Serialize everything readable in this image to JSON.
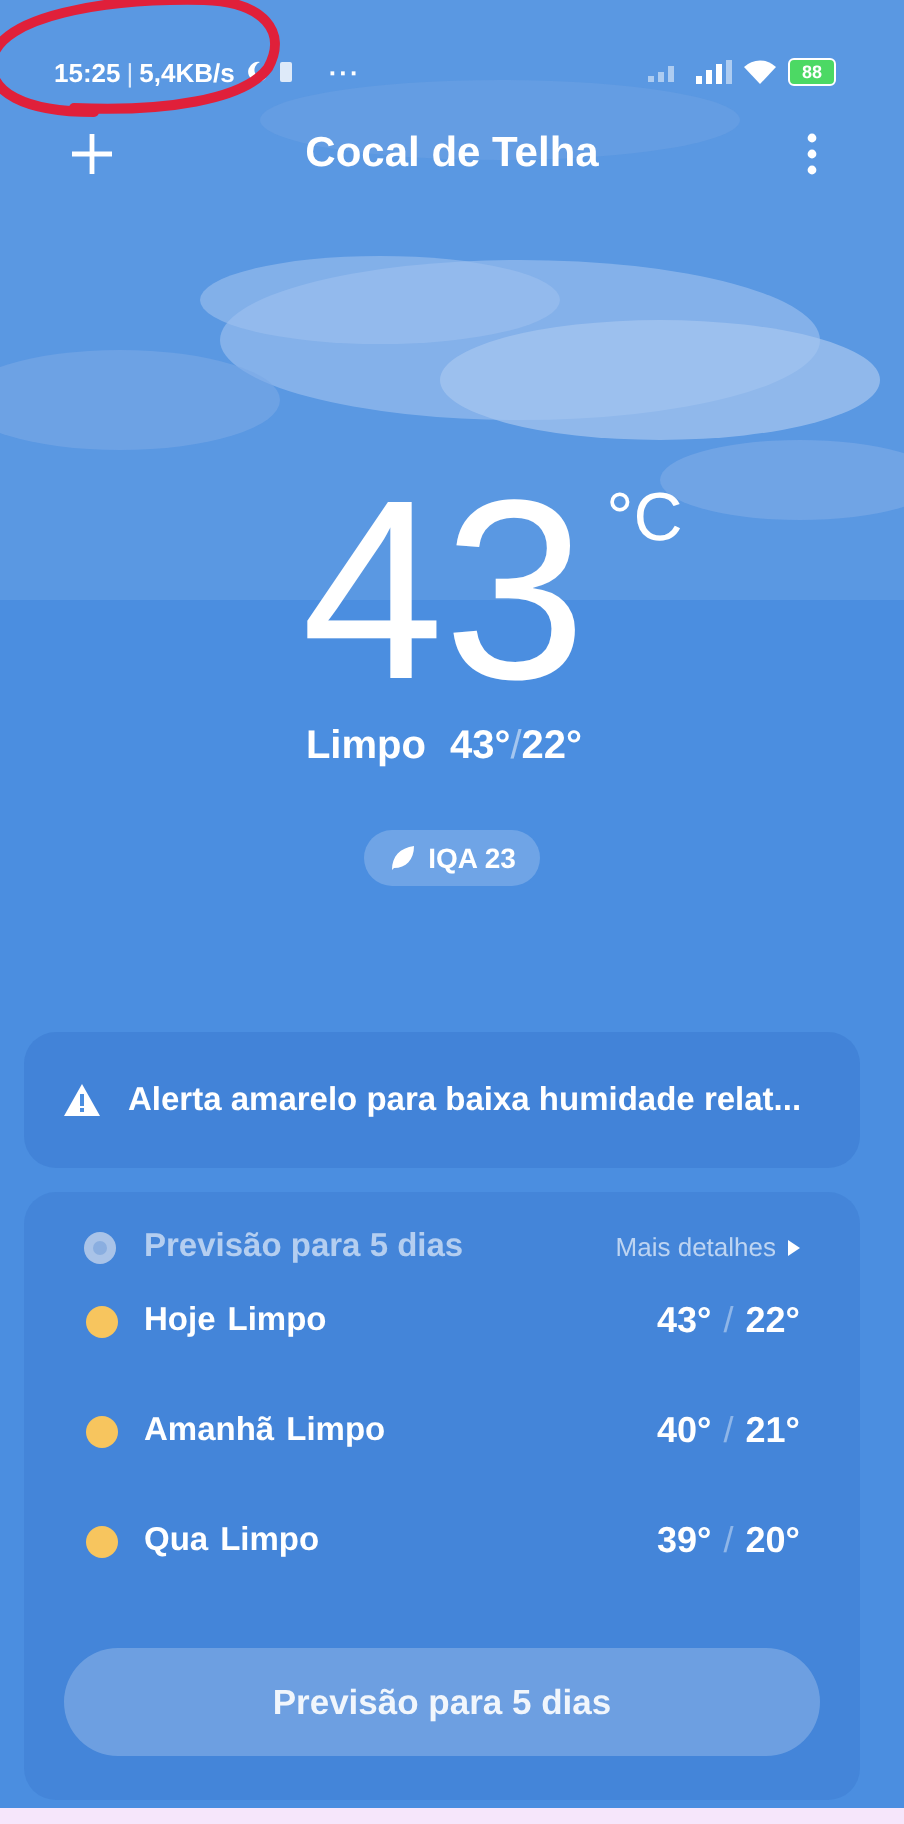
{
  "status_bar": {
    "time": "15:25",
    "separator": "|",
    "speed": "5,4KB/s",
    "more": "···",
    "battery": "88"
  },
  "header": {
    "title": "Cocal de Telha"
  },
  "current": {
    "temperature": "43",
    "unit": "°C",
    "condition": "Limpo",
    "high": "43°",
    "separator": "/",
    "low": "22°",
    "aqi": "IQA 23"
  },
  "alert": {
    "text": "Alerta amarelo para baixa humidade relat..."
  },
  "forecast": {
    "title": "Previsão para 5 dias",
    "more": "Mais detalhes",
    "days": [
      {
        "day": "Hoje",
        "condition": "Limpo",
        "high": "43°",
        "low": "22°",
        "color": "#f7c55e"
      },
      {
        "day": "Amanhã",
        "condition": "Limpo",
        "high": "40°",
        "low": "21°",
        "color": "#f7c55e"
      },
      {
        "day": "Qua",
        "condition": "Limpo",
        "high": "39°",
        "low": "20°",
        "color": "#f7c55e"
      }
    ],
    "button": "Previsão para 5 dias"
  }
}
